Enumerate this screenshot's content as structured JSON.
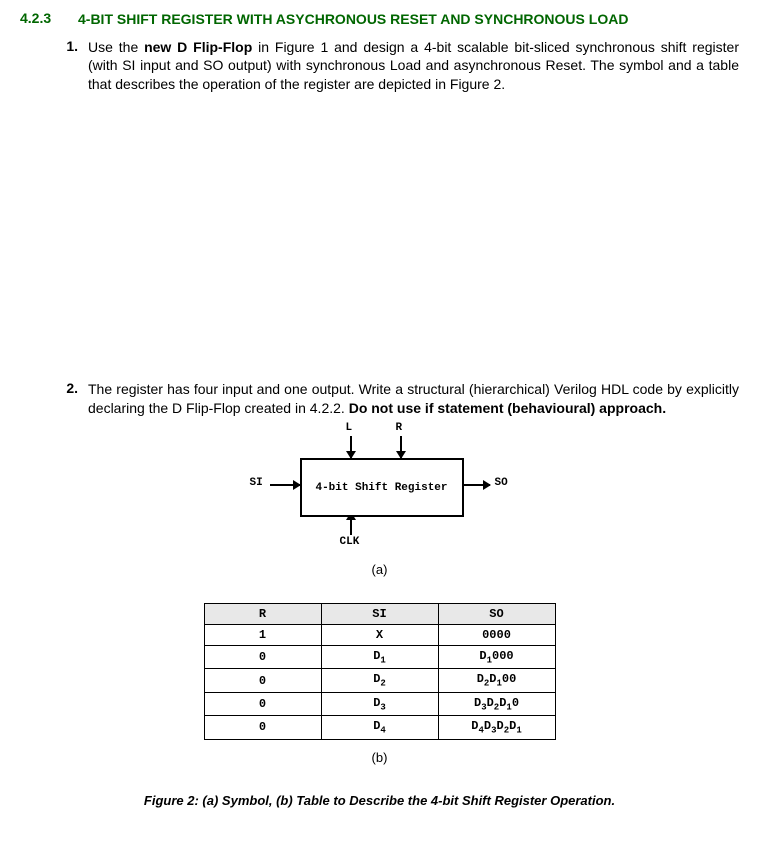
{
  "section": {
    "number": "4.2.3",
    "title": "4-BIT SHIFT REGISTER WITH ASYCHRONOUS RESET AND SYNCHRONOUS LOAD"
  },
  "item1": {
    "number": "1.",
    "pre": "Use the ",
    "bold": "new D Flip-Flop",
    "post": " in Figure 1 and design a 4-bit scalable bit-sliced synchronous shift register (with SI input and SO output) with synchronous Load and asynchronous Reset. The symbol and a table that describes the operation of the register are depicted in Figure 2."
  },
  "item2": {
    "number": "2.",
    "pre": "The register has four input and one output. Write a structural (hierarchical) Verilog HDL code by explicitly declaring the D Flip-Flop created in 4.2.2. ",
    "bold": "Do not use if statement (behavioural) approach."
  },
  "diagram": {
    "box": "4-bit Shift Register",
    "L": "L",
    "R": "R",
    "SI": "SI",
    "SO": "SO",
    "CLK": "CLK",
    "a": "(a)",
    "b": "(b)"
  },
  "table": {
    "headers": [
      "R",
      "SI",
      "SO"
    ],
    "rows": [
      [
        "1",
        "X",
        "0000"
      ],
      [
        "0",
        "D<sub>1</sub>",
        "D<sub>1</sub>000"
      ],
      [
        "0",
        "D<sub>2</sub>",
        "D<sub>2</sub>D<sub>1</sub>00"
      ],
      [
        "0",
        "D<sub>3</sub>",
        "D<sub>3</sub>D<sub>2</sub>D<sub>1</sub>0"
      ],
      [
        "0",
        "D<sub>4</sub>",
        "D<sub>4</sub>D<sub>3</sub>D<sub>2</sub>D<sub>1</sub>"
      ]
    ]
  },
  "caption": "Figure 2: (a) Symbol, (b) Table to Describe the 4-bit Shift Register Operation."
}
